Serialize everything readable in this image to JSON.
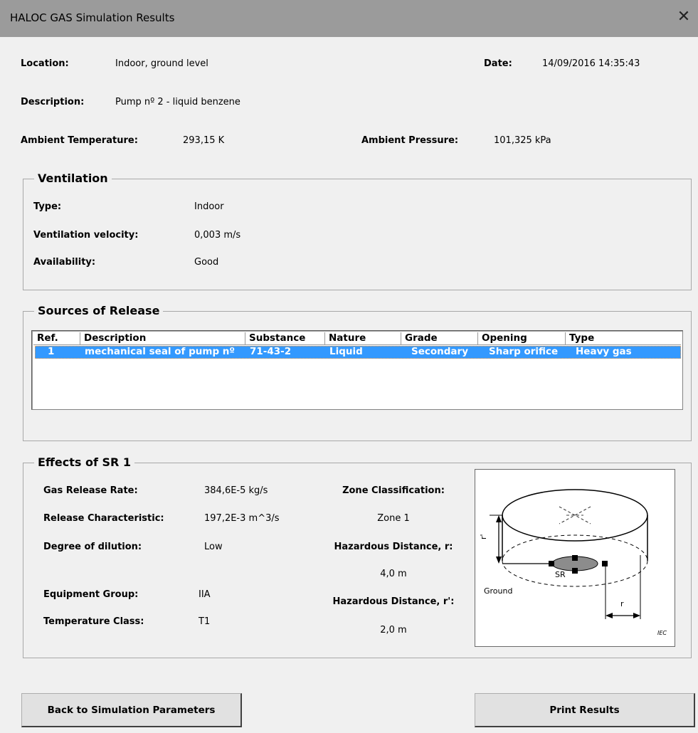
{
  "window": {
    "title": "HALOC GAS Simulation Results",
    "close_glyph": "✕"
  },
  "header": {
    "location_label": "Location:",
    "location_value": "Indoor, ground level",
    "date_label": "Date:",
    "date_value": "14/09/2016 14:35:43",
    "description_label": "Description:",
    "description_value": "Pump nº 2 - liquid benzene",
    "ambient_temp_label": "Ambient Temperature:",
    "ambient_temp_value": "293,15 K",
    "ambient_pressure_label": "Ambient Pressure:",
    "ambient_pressure_value": "101,325 kPa"
  },
  "ventilation": {
    "title": "Ventilation",
    "type_label": "Type:",
    "type_value": "Indoor",
    "velocity_label": "Ventilation velocity:",
    "velocity_value": "0,003 m/s",
    "availability_label": "Availability:",
    "availability_value": "Good"
  },
  "sources": {
    "title": "Sources of Release",
    "columns": [
      "Ref.",
      "Description",
      "Substance",
      "Nature",
      "Grade",
      "Opening",
      "Type"
    ],
    "rows": [
      [
        "1",
        "mechanical seal of pump nº",
        "71-43-2",
        "Liquid",
        "Secondary",
        "Sharp orifice",
        "Heavy gas"
      ]
    ]
  },
  "effects": {
    "title": "Effects of SR 1",
    "gas_release_rate_label": "Gas Release Rate:",
    "gas_release_rate_value": "384,6E-5 kg/s",
    "release_char_label": "Release Characteristic:",
    "release_char_value": "197,2E-3 m^3/s",
    "dilution_label": "Degree of dilution:",
    "dilution_value": "Low",
    "equipment_group_label": "Equipment Group:",
    "equipment_group_value": "IIA",
    "temp_class_label": "Temperature Class:",
    "temp_class_value": "T1",
    "zone_label": "Zone Classification:",
    "zone_value": "Zone 1",
    "hazard_r_label": "Hazardous Distance, r:",
    "hazard_r_value": "4,0 m",
    "hazard_r2_label": "Hazardous Distance, r':",
    "hazard_r2_value": "2,0 m",
    "diagram": {
      "sr_label": "SR",
      "ground_label": "Ground",
      "r_label": "r",
      "r2_label": "r'",
      "iec_label": "IEC"
    }
  },
  "buttons": {
    "back_label": "Back to Simulation Parameters",
    "print_label": "Print Results"
  }
}
